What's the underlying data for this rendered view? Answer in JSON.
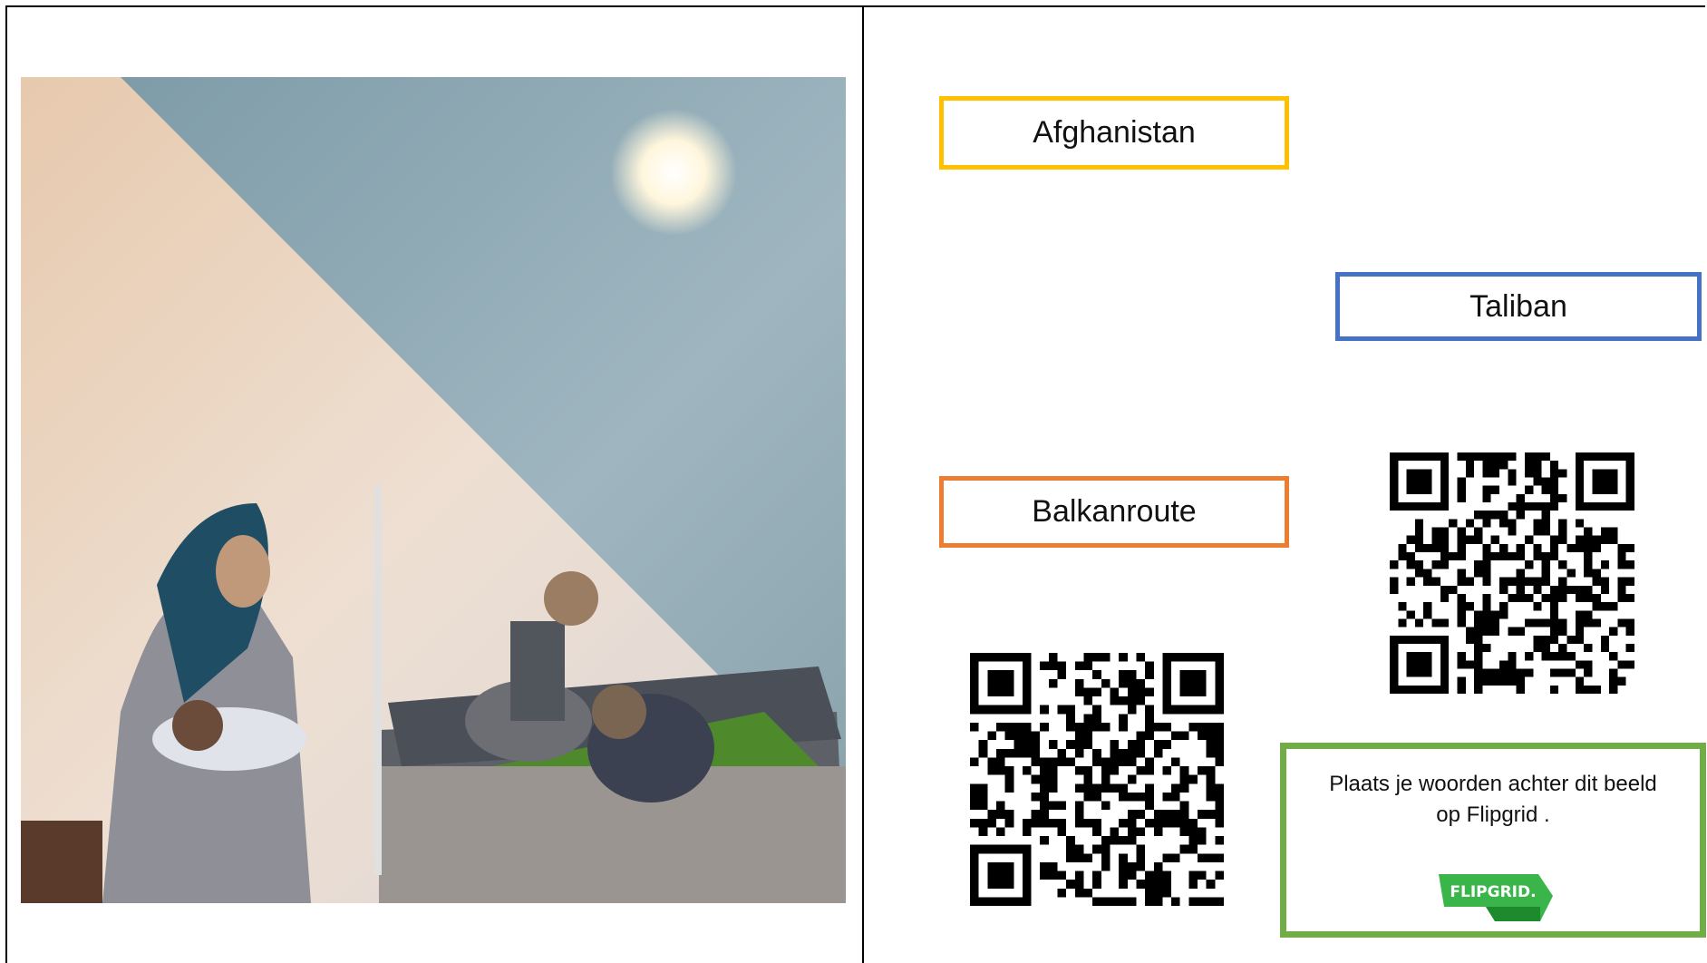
{
  "labels": {
    "afghanistan": "Afghanistan",
    "taliban": "Taliban",
    "balkanroute": "Balkanroute"
  },
  "flipgrid_box": {
    "instruction": "Plaats je woorden achter dit beeld op Flipgrid .",
    "logo_text": "FLIPGRID."
  },
  "colors": {
    "afghanistan_border": "#ffc000",
    "taliban_border": "#4472c4",
    "balkanroute_border": "#ed7d31",
    "flipgrid_border": "#70ad47",
    "flipgrid_logo": "#3ab54a"
  },
  "icons": {
    "photo": "refugee-family-photo",
    "qr_top": "qr-code",
    "qr_bottom": "qr-code",
    "logo": "flipgrid-logo"
  }
}
